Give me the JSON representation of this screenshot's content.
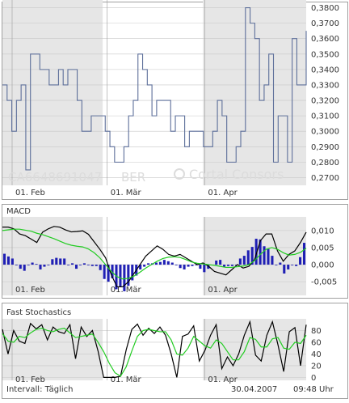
{
  "colors": {
    "price_line": "#5d6f9a",
    "macd_line": "#000000",
    "signal_line": "#22cc22",
    "histogram": "#1f1fb4",
    "stoch_k": "#000000",
    "stoch_d": "#22cc22",
    "shade": "#e6e6e6",
    "grid": "#c8c8c8",
    "frame": "#a0a0a0",
    "text": "#333333",
    "watermark": "#dcdcdc"
  },
  "watermark": {
    "isin": "CA6648691047",
    "exchange": "BER",
    "brand": "Cortal Consors"
  },
  "footer": {
    "interval_label": "Intervall: Täglich",
    "date": "30.04.2007",
    "time": "09:48 Uhr"
  },
  "chart_data": [
    {
      "type": "line",
      "panel": "price",
      "title": "",
      "x_labels": [
        "01. Feb",
        "01. Mär",
        "01. Apr"
      ],
      "ylim": [
        0.265,
        0.385
      ],
      "y_ticks": [
        0.27,
        0.28,
        0.29,
        0.3,
        0.31,
        0.32,
        0.33,
        0.34,
        0.35,
        0.36,
        0.37,
        0.38
      ],
      "y_tick_labels": [
        "0,2700",
        "0,2800",
        "0,2900",
        "0,3000",
        "0,3100",
        "0,3200",
        "0,3300",
        "0,3400",
        "0,3500",
        "0,3600",
        "0,3700",
        "0,3800"
      ],
      "shading": "alternating months (Jan, Mar, Apr gray)",
      "series": [
        {
          "values": [
            0.33,
            0.32,
            0.3,
            0.32,
            0.33,
            0.275,
            0.35,
            0.35,
            0.34,
            0.34,
            0.33,
            0.33,
            0.34,
            0.33,
            0.34,
            0.34,
            0.32,
            0.3,
            0.3,
            0.31,
            0.31,
            0.31,
            0.3,
            0.29,
            0.28,
            0.28,
            0.29,
            0.31,
            0.32,
            0.35,
            0.34,
            0.33,
            0.31,
            0.32,
            0.32,
            0.32,
            0.3,
            0.31,
            0.31,
            0.29,
            0.3,
            0.3,
            0.3,
            0.29,
            0.29,
            0.3,
            0.32,
            0.31,
            0.28,
            0.28,
            0.29,
            0.3,
            0.38,
            0.37,
            0.36,
            0.32,
            0.33,
            0.35,
            0.28,
            0.31,
            0.31,
            0.28,
            0.36,
            0.33,
            0.33,
            0.365
          ]
        }
      ]
    },
    {
      "type": "line",
      "panel": "MACD",
      "title": "MACD",
      "x_labels": [
        "01. Feb",
        "01. Mär",
        "01. Apr"
      ],
      "ylim": [
        -0.009,
        0.014
      ],
      "y_ticks": [
        -0.005,
        0.0,
        0.005,
        0.01
      ],
      "y_tick_labels": [
        "-0,005",
        "0,000",
        "0,005",
        "0,010"
      ],
      "series": [
        {
          "values": [
            0.011,
            0.011,
            0.0105,
            0.009,
            0.0085,
            0.0075,
            0.0065,
            0.0095,
            0.0105,
            0.0112,
            0.011,
            0.0102,
            0.0096,
            0.0097,
            0.0099,
            0.0089,
            0.0067,
            0.0045,
            0.002,
            -0.003,
            -0.0065,
            -0.0065,
            -0.005,
            -0.0025,
            0.0,
            0.0025,
            0.004,
            0.0055,
            0.0045,
            0.003,
            0.0025,
            0.003,
            0.002,
            0.001,
            0.0,
            0.0005,
            -0.0005,
            -0.002,
            -0.0025,
            -0.003,
            -0.0015,
            0.0,
            -0.001,
            -0.0005,
            0.0015,
            0.007,
            0.009,
            0.009,
            0.004,
            0.001,
            0.003,
            0.004,
            0.0065,
            0.0095
          ]
        },
        {
          "values": [
            0.01,
            0.0102,
            0.0104,
            0.0104,
            0.0101,
            0.0098,
            0.0092,
            0.0088,
            0.0082,
            0.0076,
            0.0069,
            0.0062,
            0.0057,
            0.0054,
            0.0052,
            0.0046,
            0.0035,
            0.002,
            0.0,
            -0.002,
            -0.0035,
            -0.0042,
            -0.004,
            -0.0033,
            -0.0022,
            -0.001,
            0.0,
            0.001,
            0.0018,
            0.0022,
            0.0023,
            0.0021,
            0.0015,
            0.0008,
            0.0004,
            0.0002,
            0.0,
            -0.0002,
            -0.0005,
            -0.0008,
            -0.0008,
            -0.0006,
            -0.0004,
            0.0,
            0.0012,
            0.003,
            0.0045,
            0.005,
            0.0045,
            0.0035,
            0.0028,
            0.003,
            0.0036,
            0.0048
          ]
        },
        {
          "values": [
            0.0032,
            0.0024,
            0.0018,
            0.0,
            -0.0012,
            -0.0018,
            0.0,
            0.0006,
            0.0002,
            -0.0014,
            -0.0006,
            0.0,
            0.0016,
            0.002,
            0.0018,
            0.0018,
            0.0,
            0.0004,
            -0.0012,
            0.0,
            0.0004,
            0.0,
            -0.0004,
            -0.0004,
            -0.0016,
            -0.0042,
            -0.005,
            -0.004,
            -0.0072,
            -0.0064,
            -0.0078,
            -0.0062,
            -0.0046,
            -0.0032,
            -0.0014,
            -0.0006,
            0.0004,
            0.0004,
            0.0006,
            0.0008,
            0.0014,
            0.001,
            0.0006,
            -0.0002,
            -0.001,
            -0.0014,
            -0.0006,
            -0.0004,
            0.0,
            -0.0012,
            -0.0022,
            -0.0012,
            0.0,
            0.0012,
            0.0014,
            -0.0006,
            -0.0004,
            -0.0004,
            0.0,
            0.0018,
            0.0026,
            0.0042,
            0.0052,
            0.0076,
            0.0074,
            0.0054,
            0.0046,
            0.0026,
            0.0,
            0.0006,
            -0.0026,
            -0.0014,
            0.0,
            -0.0004,
            0.0022,
            0.0064
          ]
        }
      ]
    },
    {
      "type": "line",
      "panel": "Fast Stochastics",
      "title": "Fast Stochastics",
      "x_labels": [
        "01. Feb",
        "01. Mär",
        "01. Apr"
      ],
      "ylim": [
        -5,
        100
      ],
      "y_ticks": [
        0,
        20,
        40,
        60,
        80
      ],
      "y_tick_labels": [
        "0",
        "20",
        "40",
        "60",
        "80"
      ],
      "series": [
        {
          "values": [
            82,
            40,
            80,
            62,
            58,
            92,
            83,
            90,
            64,
            86,
            78,
            75,
            90,
            32,
            86,
            70,
            80,
            45,
            0,
            0,
            0,
            2,
            47,
            82,
            91,
            72,
            84,
            75,
            86,
            72,
            40,
            0,
            70,
            74,
            88,
            28,
            46,
            72,
            90,
            15,
            35,
            20,
            40,
            72,
            95,
            38,
            28,
            72,
            95,
            55,
            10,
            78,
            85,
            20,
            90
          ]
        },
        {
          "values": [
            75,
            62,
            60,
            70,
            68,
            76,
            82,
            84,
            80,
            78,
            82,
            84,
            76,
            68,
            70,
            72,
            74,
            60,
            44,
            24,
            8,
            2,
            18,
            45,
            70,
            80,
            82,
            80,
            78,
            78,
            64,
            40,
            38,
            50,
            70,
            62,
            54,
            50,
            64,
            58,
            44,
            30,
            30,
            44,
            68,
            65,
            52,
            52,
            66,
            68,
            50,
            48,
            60,
            58,
            72
          ]
        }
      ]
    }
  ]
}
